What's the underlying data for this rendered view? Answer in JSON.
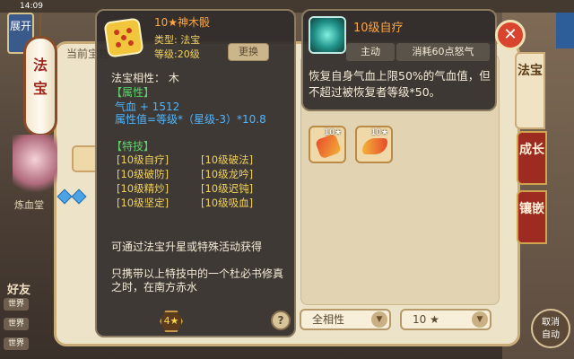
{
  "status_bar": {
    "time": "14:09"
  },
  "background": {
    "top_left_button": "展开",
    "lantern_title": "法宝",
    "left_label": "炼血堂",
    "friends_label": "好友",
    "chat_channels": [
      "世界",
      "世界",
      "世界"
    ],
    "panel_title": "当前宝物"
  },
  "item_tooltip": {
    "name": "10★神木骰",
    "type_line": "类型: 法宝",
    "level_line": "等级:20级",
    "replace_button": "更换",
    "affinity_line": "法宝相性： 木",
    "attributes_header": "【属性】",
    "hp_line": "气血 + 1512",
    "attr_formula": "属性值=等级*（星级-3）*10.8",
    "skills_header": "【特技】",
    "skills": [
      "[10级自疗]",
      "[10级破法]",
      "[10级破防]",
      "[10级龙吟]",
      "[10级精炒]",
      "[10级迟钝]",
      "[10级坚定]",
      "[10级吸血]"
    ],
    "desc_1": "可通过法宝升星或特殊活动获得",
    "desc_2": "只携带以上特技中的一个杜必书修真之时，在南方赤水",
    "star_badge": "4★"
  },
  "skill_tooltip": {
    "name": "10级自疗",
    "type": "主动",
    "cost": "消耗60点怒气",
    "description": "恢复自身气血上限50%的气血值，但不超过被恢复者等级*50。"
  },
  "slots": [
    {
      "badge": "10★",
      "icon": "red-scroll-icon"
    },
    {
      "badge": "10★",
      "icon": "golden-horn-icon"
    }
  ],
  "tabs": {
    "active": "法宝",
    "grow": "成长",
    "inlay": "镶嵌"
  },
  "filters": {
    "help": "?",
    "affinity_value": "全相性",
    "star_value": "10 ★"
  },
  "auto_button": {
    "line1": "取消",
    "line2": "自动"
  }
}
